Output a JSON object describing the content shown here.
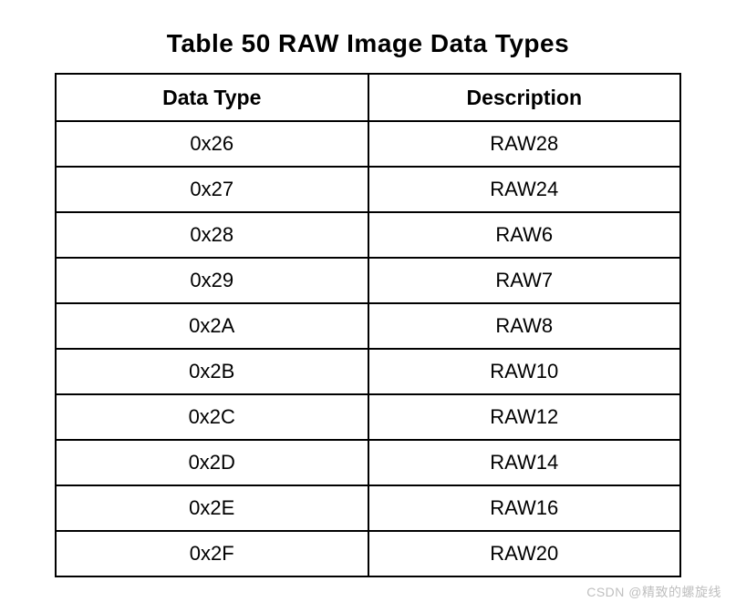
{
  "chart_data": {
    "type": "table",
    "title": "Table 50 RAW Image Data Types",
    "columns": [
      "Data Type",
      "Description"
    ],
    "rows": [
      {
        "data_type": "0x26",
        "description": "RAW28"
      },
      {
        "data_type": "0x27",
        "description": "RAW24"
      },
      {
        "data_type": "0x28",
        "description": "RAW6"
      },
      {
        "data_type": "0x29",
        "description": "RAW7"
      },
      {
        "data_type": "0x2A",
        "description": "RAW8"
      },
      {
        "data_type": "0x2B",
        "description": "RAW10"
      },
      {
        "data_type": "0x2C",
        "description": "RAW12"
      },
      {
        "data_type": "0x2D",
        "description": "RAW14"
      },
      {
        "data_type": "0x2E",
        "description": "RAW16"
      },
      {
        "data_type": "0x2F",
        "description": "RAW20"
      }
    ]
  },
  "watermark": "CSDN @精致的螺旋线"
}
